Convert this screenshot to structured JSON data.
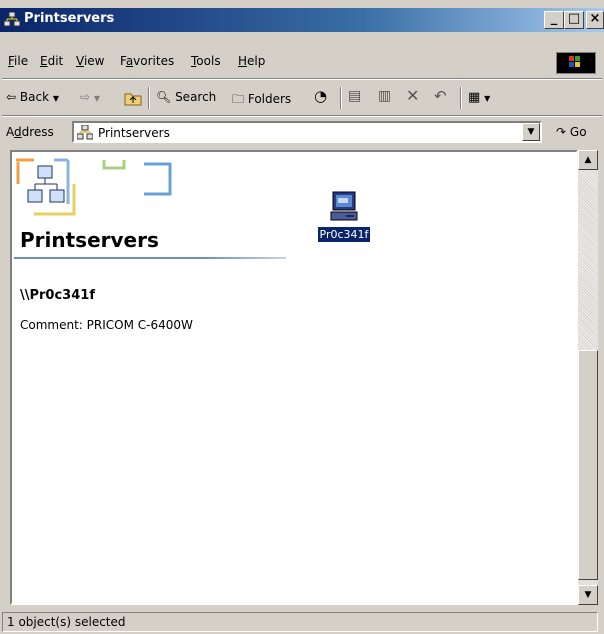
{
  "window": {
    "title": "Printservers"
  },
  "menu": {
    "items": [
      {
        "label": "File",
        "u": "F",
        "rest": "ile"
      },
      {
        "label": "Edit",
        "u": "E",
        "rest": "dit"
      },
      {
        "label": "View",
        "u": "V",
        "rest": "iew"
      },
      {
        "label": "Favorites",
        "pre": "F",
        "u": "a",
        "rest": "vorites"
      },
      {
        "label": "Tools",
        "u": "T",
        "rest": "ools"
      },
      {
        "label": "Help",
        "u": "H",
        "rest": "elp"
      }
    ]
  },
  "toolbar": {
    "back_label": "Back",
    "search_label": "Search",
    "folders_label": "Folders"
  },
  "address": {
    "label_pre": "A",
    "label_u": "d",
    "label_rest": "dress",
    "value": "Printservers",
    "go_label": "Go"
  },
  "content": {
    "folder_title": "Printservers",
    "server_name": "\\\\Pr0c341f",
    "comment": "Comment: PRICOM C-6400W",
    "item_label": "Pr0c341f"
  },
  "status": {
    "text": "1 object(s) selected"
  },
  "colors": {
    "title_start": "#0a246a",
    "title_end": "#a6caf0",
    "selection": "#0a246a",
    "chrome": "#d4d0c8"
  }
}
